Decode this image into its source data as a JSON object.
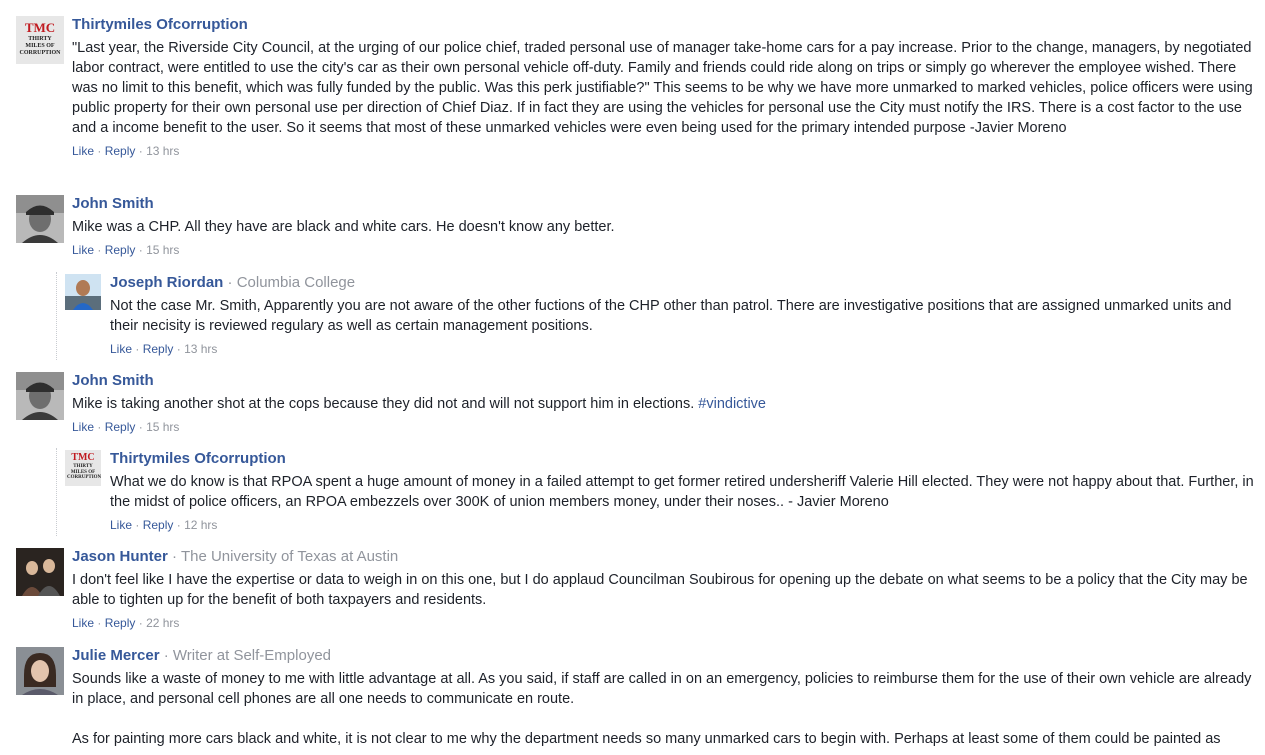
{
  "actions": {
    "like": "Like",
    "reply": "Reply",
    "dot": "·"
  },
  "comments": [
    {
      "author": "Thirtymiles Ofcorruption",
      "avatar_logo": {
        "main": "TMC",
        "sub": "THIRTY MILES OF CORRUPTION"
      },
      "text": "\"Last year, the Riverside City Council, at the urging of our police chief, traded personal use of manager take-home cars for a pay increase. Prior to the change, managers, by negotiated labor contract, were entitled to use the city's car as their own personal vehicle off-duty. Family and friends could ride along on trips or simply go wherever the employee wished. There was no limit to this benefit, which was fully funded by the public. Was this perk justifiable?\" This seems to be why we have more unmarked to marked vehicles, police officers were using public property for their own personal use per direction of Chief Diaz. If in fact they are using the vehicles for personal use the City must notify the IRS. There is a cost factor to the use and a income benefit to the user. So it seems that most of these unmarked vehicles were even being used for the primary intended purpose -Javier Moreno",
      "time": "13 hrs"
    },
    {
      "author": "John Smith",
      "text": "Mike was a CHP. All they have are black and white cars. He doesn't know any better.",
      "time": "15 hrs"
    },
    {
      "author": "Joseph Riordan",
      "affiliation": "Columbia College",
      "text": "Not the case Mr. Smith, Apparently you are not aware of the other fuctions of the CHP other than patrol. There are investigative positions that are assigned unmarked units and their necisity is reviewed regulary as well as certain management positions.",
      "time": "13 hrs"
    },
    {
      "author": "John Smith",
      "text": "Mike is taking another shot at the cops because they did not and will not support him in elections.",
      "hashtag": "#vindictive",
      "time": "15 hrs"
    },
    {
      "author": "Thirtymiles Ofcorruption",
      "avatar_logo": {
        "main": "TMC",
        "sub": "THIRTY MILES OF CORRUPTION"
      },
      "text": "What we do know is that RPOA spent a huge amount of money in a failed attempt to get former retired undersheriff Valerie Hill elected. They were not happy about that. Further, in the midst of police officers, an RPOA embezzels over 300K of union members money, under their noses.. - Javier Moreno",
      "time": "12 hrs"
    },
    {
      "author": "Jason Hunter",
      "affiliation": "The University of Texas at Austin",
      "text": "I don't feel like I have the expertise or data to weigh in on this one, but I do applaud Councilman Soubirous for opening up the debate on what seems to be a policy that the City may be able to tighten up for the benefit of both taxpayers and residents.",
      "time": "22 hrs"
    },
    {
      "author": "Julie Mercer",
      "affiliation": "Writer at Self-Employed",
      "text": "Sounds like a waste of money to me with little advantage at all. As you said, if staff are called in on an emergency, policies to reimburse them for the use of their own vehicle are already in place, and personal cell phones are all one needs to communicate en route.",
      "text2": "As for painting more cars black and white, it is not clear to me why the department needs so many unmarked cars to begin with. Perhaps at least some of them could be painted as"
    }
  ]
}
